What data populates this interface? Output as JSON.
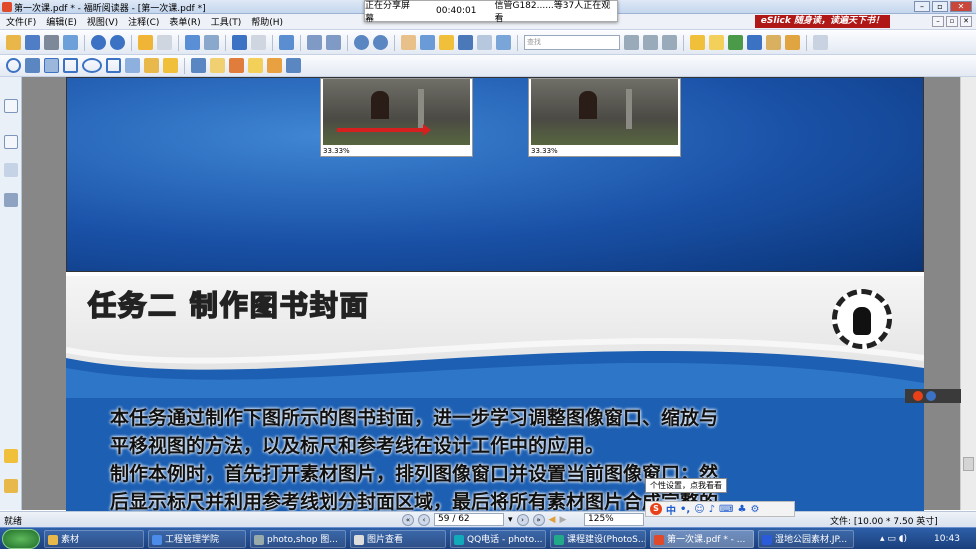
{
  "window": {
    "title": "第一次课.pdf * - 福昕阅读器 - [第一次课.pdf *]"
  },
  "share_banner": {
    "status": "正在分享屏幕",
    "timer": "00:40:01",
    "viewers": "信管G182......等37人正在观看"
  },
  "menu": {
    "items": [
      "文件(F)",
      "编辑(E)",
      "视图(V)",
      "注释(C)",
      "表单(R)",
      "工具(T)",
      "帮助(H)"
    ],
    "promo": "eSlick 随身读，读遍天下书！"
  },
  "toolbar": {
    "search_placeholder": "查找",
    "icons": [
      "open-icon",
      "save-icon",
      "print-icon",
      "email-icon",
      "page-up-icon",
      "page-down-icon",
      "back-icon",
      "forward-icon",
      "select-icon",
      "snapshot-icon",
      "undo-icon",
      "redo-icon",
      "zoom-icon",
      "fit-page-icon",
      "fit-width-icon",
      "zoom-out-icon",
      "zoom-in-icon",
      "hand-icon",
      "bookmark-icon",
      "pointer-icon",
      "find-icon",
      "text-icon",
      "image-icon"
    ]
  },
  "slide1": {
    "thumb_left_zoom": "33.33%",
    "thumb_right_zoom": "33.33%"
  },
  "slide2": {
    "title": "任务二 制作图书封面",
    "body_lines": [
      "本任务通过制作下图所示的图书封面，进一步学习调整图像窗口、缩放与",
      "平移视图的方法，以及标尺和参考线在设计工作中的应用。",
      "制作本例时，首先打开素材图片，排列图像窗口并设置当前图像窗口；然",
      "后显示标尺并利用参考线划分封面区域，最后将所有素材图片合成完整的"
    ]
  },
  "ime": {
    "tooltip": "个性设置，点我看看",
    "mode": "中"
  },
  "status": {
    "ready": "就绪",
    "page": "59 / 62",
    "zoom": "125%",
    "doc_size": "文件: [10.00 * 7.50 英寸]"
  },
  "taskbar": {
    "tasks": [
      {
        "label": "素材",
        "color": "#e8b84a"
      },
      {
        "label": "工程管理学院",
        "color": "#4a8ce8"
      },
      {
        "label": "photo,shop 图...",
        "color": "#9aa"
      },
      {
        "label": "图片查看",
        "color": "#ddd"
      },
      {
        "label": "QQ电话 - photo...",
        "color": "#1ab"
      },
      {
        "label": "课程建设(PhotoS...",
        "color": "#2a8"
      },
      {
        "label": "第一次课.pdf * - ...",
        "color": "#e04a2a"
      },
      {
        "label": "湿地公园素材.JP...",
        "color": "#2a5bd8"
      }
    ],
    "clock": "10:43"
  }
}
